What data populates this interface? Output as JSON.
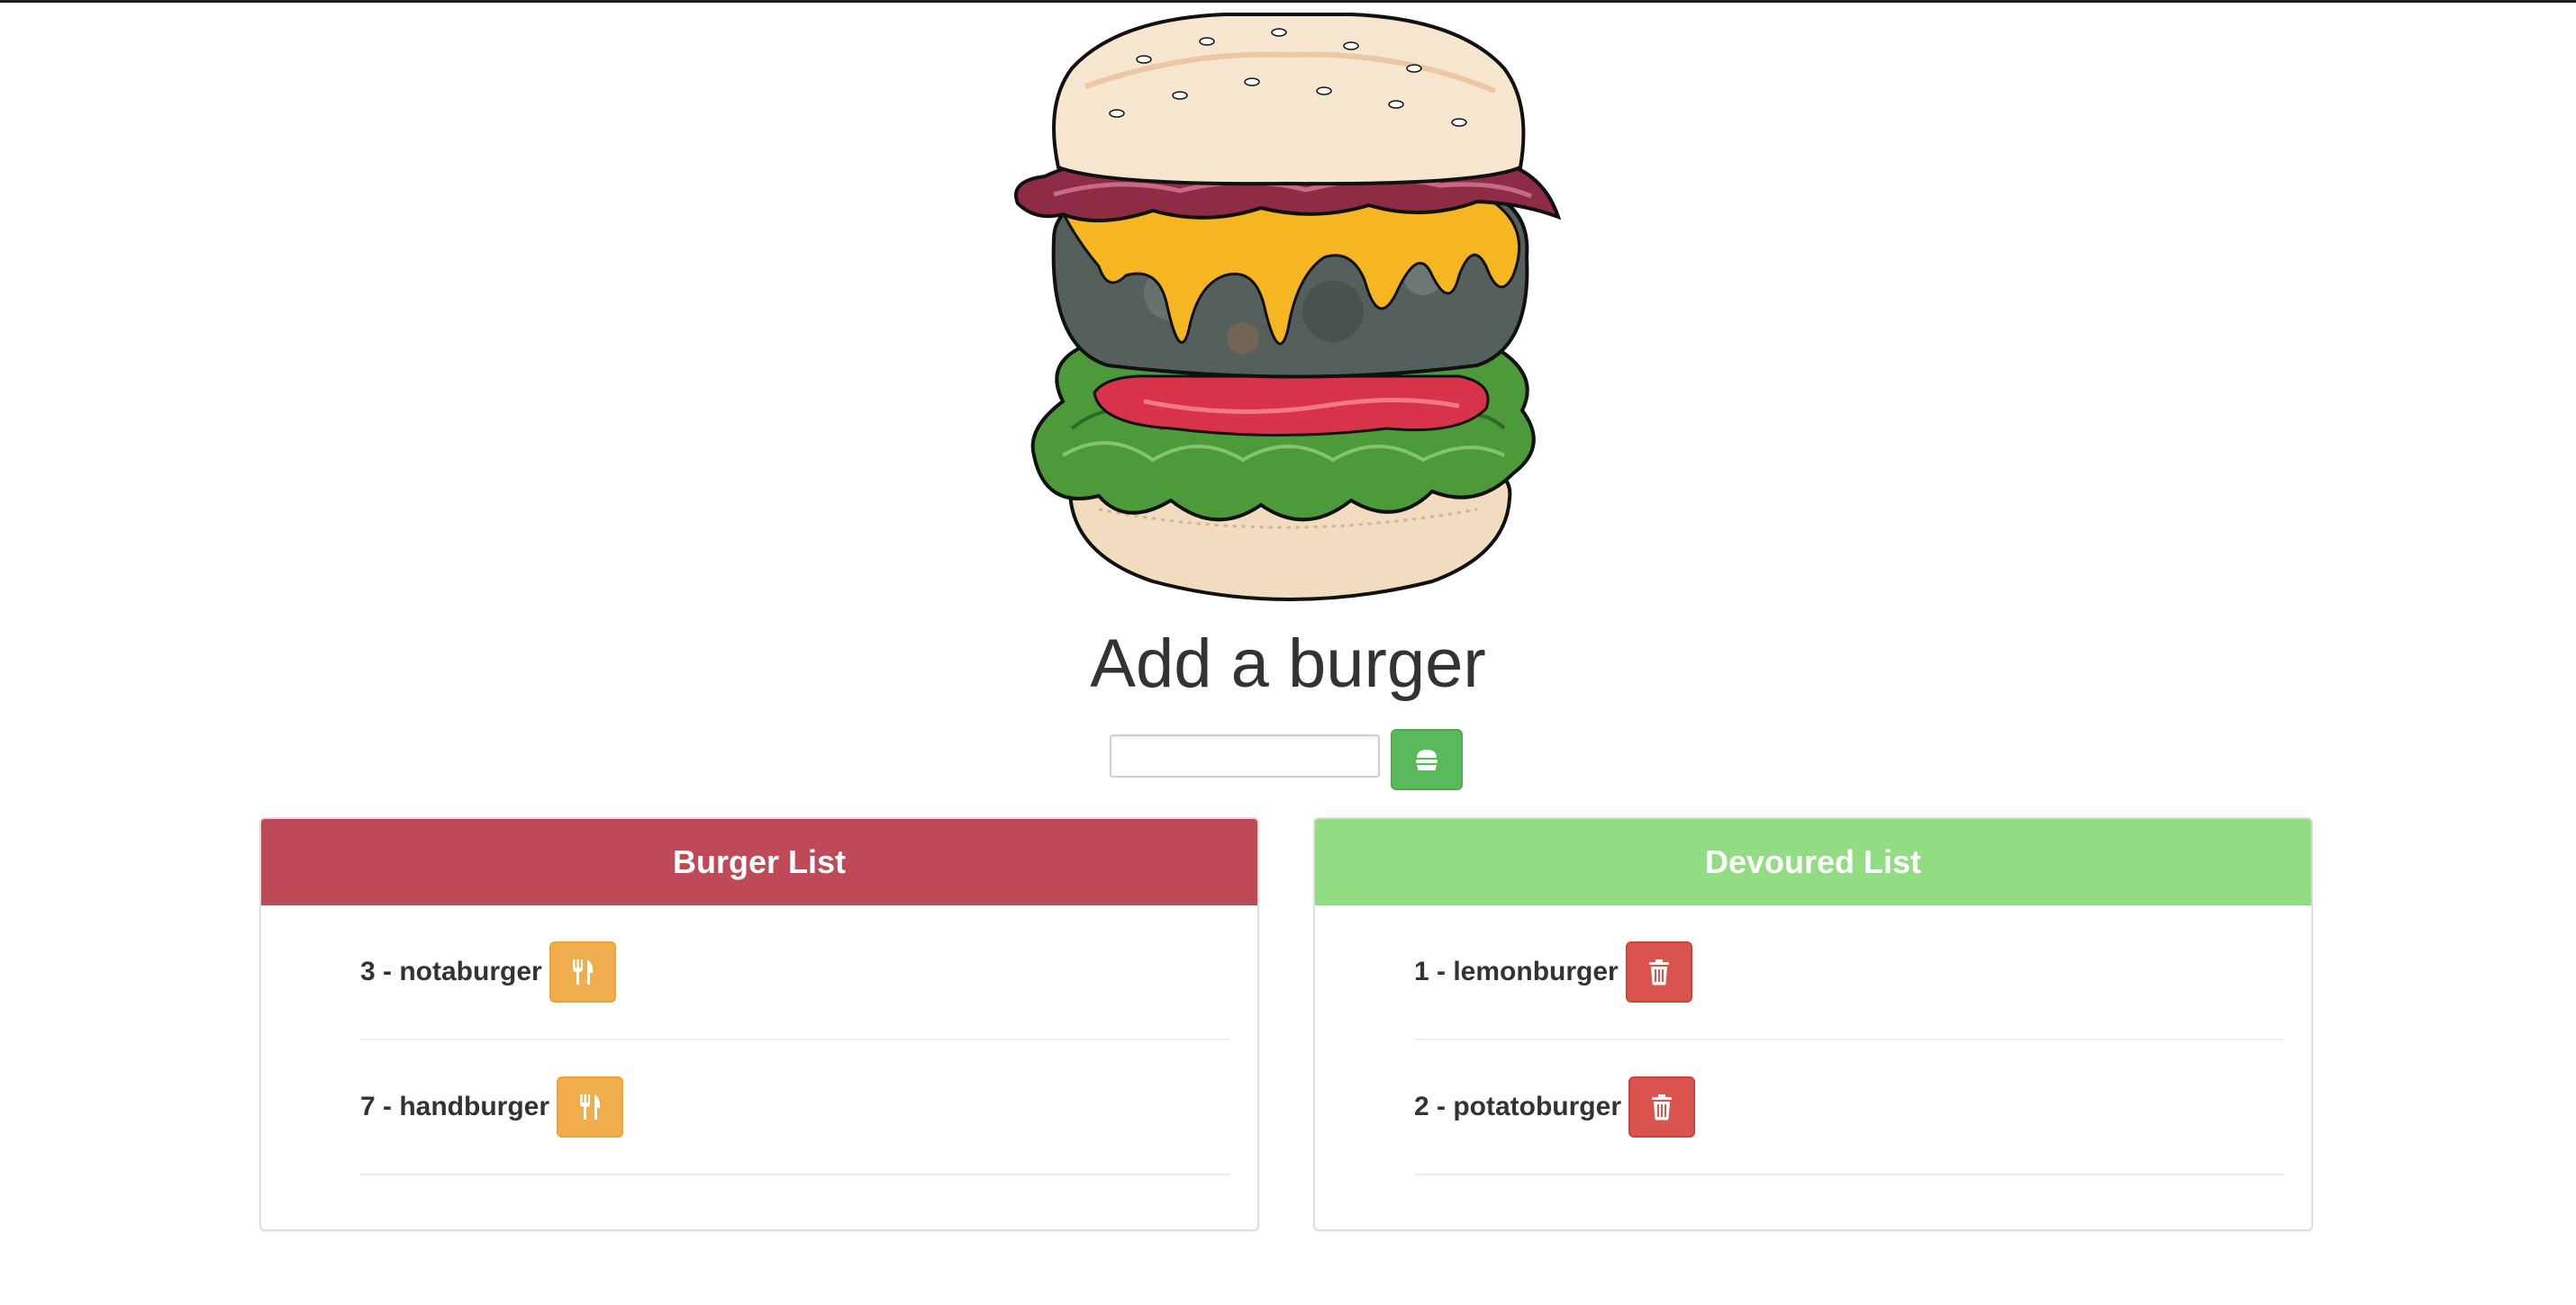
{
  "page": {
    "heading": "Add a burger"
  },
  "add_form": {
    "input_value": "",
    "input_placeholder": "",
    "submit_icon": "burger-icon"
  },
  "burger_list": {
    "title": "Burger List",
    "header_color": "#bf4a57",
    "action_icon": "utensils-icon",
    "action_color": "#f0ad4e",
    "items": [
      {
        "label": "3 - notaburger"
      },
      {
        "label": "7 - handburger"
      }
    ]
  },
  "devoured_list": {
    "title": "Devoured List",
    "header_color": "#92dc84",
    "action_icon": "trash-icon",
    "action_color": "#d9534f",
    "items": [
      {
        "label": "1 - lemonburger"
      },
      {
        "label": "2 - potatoburger"
      }
    ]
  },
  "colors": {
    "submit_button": "#5cb85c",
    "text": "#333333"
  }
}
